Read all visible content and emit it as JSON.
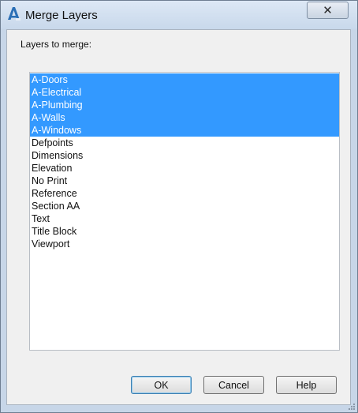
{
  "window": {
    "title": "Merge Layers",
    "app_icon": "autocad-a-icon",
    "close_glyph": "✕"
  },
  "dialog": {
    "label": "Layers to merge:",
    "layers": [
      {
        "name": "A-Doors",
        "selected": true
      },
      {
        "name": "A-Electrical",
        "selected": true
      },
      {
        "name": "A-Plumbing",
        "selected": true
      },
      {
        "name": "A-Walls",
        "selected": true
      },
      {
        "name": "A-Windows",
        "selected": true
      },
      {
        "name": "Defpoints",
        "selected": false
      },
      {
        "name": "Dimensions",
        "selected": false
      },
      {
        "name": "Elevation",
        "selected": false
      },
      {
        "name": "No Print",
        "selected": false
      },
      {
        "name": "Reference",
        "selected": false
      },
      {
        "name": "Section AA",
        "selected": false
      },
      {
        "name": "Text",
        "selected": false
      },
      {
        "name": "Title Block",
        "selected": false
      },
      {
        "name": "Viewport",
        "selected": false
      }
    ]
  },
  "buttons": {
    "ok": "OK",
    "cancel": "Cancel",
    "help": "Help"
  },
  "colors": {
    "selection": "#3399ff",
    "selection_text": "#ffffff"
  }
}
